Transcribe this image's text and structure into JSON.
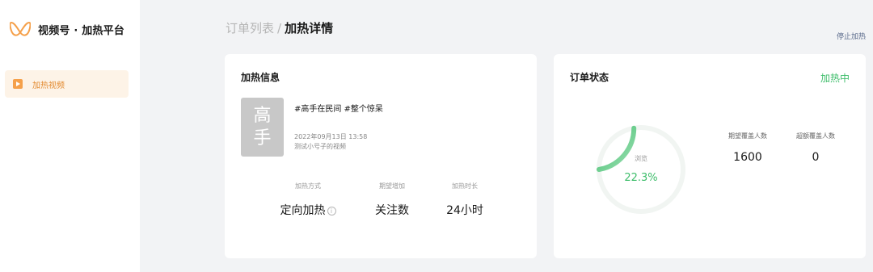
{
  "app": {
    "title": "视频号 · 加热平台"
  },
  "sidebar": {
    "items": [
      {
        "label": "加热视频",
        "icon": "play-icon",
        "active": true
      }
    ]
  },
  "breadcrumb": {
    "parent": "订单列表",
    "separator": "/",
    "current": "加热详情"
  },
  "header": {
    "stop_link": "停止加热"
  },
  "heat_info": {
    "title": "加热信息",
    "thumbnail_text": [
      "高",
      "手"
    ],
    "video": {
      "title": "#高手在民间 #整个惊呆",
      "datetime": "2022年09月13日 13:58",
      "description": "测试小号子的视频"
    },
    "stats": [
      {
        "label": "加热方式",
        "value": "定向加热",
        "has_info_icon": true
      },
      {
        "label": "期望增加",
        "value": "关注数"
      },
      {
        "label": "加热时长",
        "value": "24小时"
      }
    ],
    "info_icon_glyph": "i"
  },
  "order_status": {
    "title": "订单状态",
    "status": "加热中",
    "progress": {
      "label": "浏览",
      "value_text": "22.3%",
      "fraction": 0.223
    },
    "metrics": [
      {
        "label": "期望覆盖人数",
        "value": "1600"
      },
      {
        "label": "超额覆盖人数",
        "value": "0"
      }
    ]
  },
  "colors": {
    "accent": "#f5a04a",
    "success": "#3dbd6a",
    "link": "#5b6b8c"
  }
}
